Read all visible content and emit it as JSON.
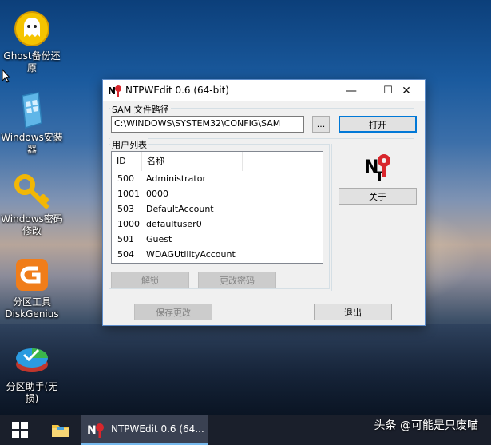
{
  "desktop": {
    "icons": [
      {
        "label": "Ghost备份还原",
        "icon": "ghost-icon"
      },
      {
        "label": "Windows安装器",
        "icon": "windows-installer-icon"
      },
      {
        "label": "Windows密码修改",
        "icon": "key-icon"
      },
      {
        "label": "分区工具DiskGenius",
        "icon": "diskgenius-icon"
      },
      {
        "label": "分区助手(无损)",
        "icon": "partition-assistant-icon"
      }
    ]
  },
  "window": {
    "title": "NTPWEdit 0.6 (64-bit)",
    "controls": {
      "minimize": "—",
      "maximize": "☐",
      "close": "✕"
    },
    "sam_group_label": "SAM 文件路径",
    "sam_path": "C:\\WINDOWS\\SYSTEM32\\CONFIG\\SAM",
    "browse_label": "...",
    "open_label": "打开",
    "users_group_label": "用户列表",
    "columns": {
      "id": "ID",
      "name": "名称"
    },
    "users": [
      {
        "id": "500",
        "name": "Administrator"
      },
      {
        "id": "1001",
        "name": "0000"
      },
      {
        "id": "503",
        "name": "DefaultAccount"
      },
      {
        "id": "1000",
        "name": "defaultuser0"
      },
      {
        "id": "501",
        "name": "Guest"
      },
      {
        "id": "504",
        "name": "WDAGUtilityAccount"
      }
    ],
    "unlock_label": "解锁",
    "change_password_label": "更改密码",
    "about_label": "关于",
    "save_label": "保存更改",
    "exit_label": "退出"
  },
  "taskbar": {
    "active_app": "NTPWEdit 0.6 (64..."
  },
  "watermark": "头条 @可能是只废喵",
  "colors": {
    "accent": "#0078d7",
    "taskbar": "#1a1f2b"
  }
}
